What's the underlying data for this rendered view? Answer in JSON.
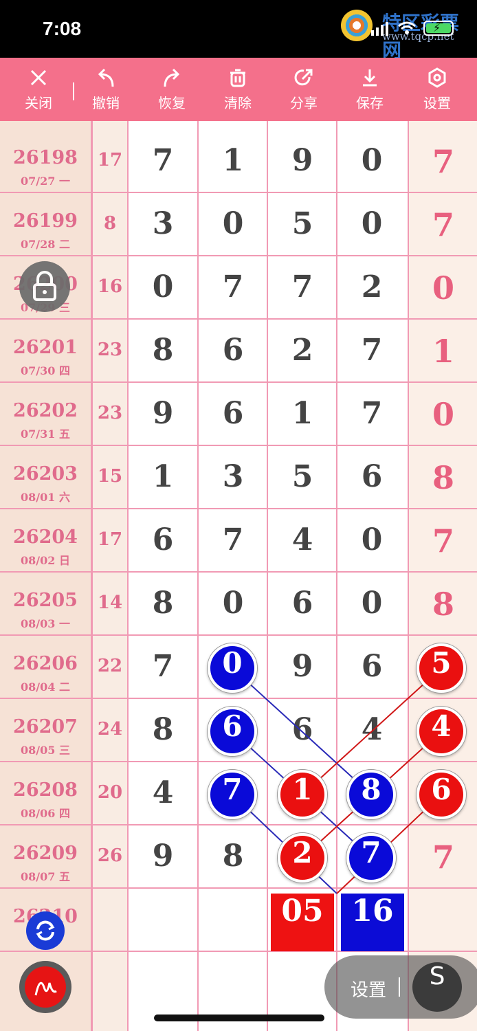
{
  "status_bar": {
    "time": "7:08"
  },
  "watermark": {
    "title": "特区彩票网",
    "url": "www.tqcp.net"
  },
  "toolbar": {
    "close": "关闭",
    "undo": "撤销",
    "redo": "恢复",
    "clear": "清除",
    "share": "分享",
    "save": "保存",
    "settings": "设置"
  },
  "rows": [
    {
      "period": "26198",
      "date": "07/27 一",
      "sum": "17",
      "digits": [
        "7",
        "1",
        "9",
        "0"
      ],
      "result": "7"
    },
    {
      "period": "26199",
      "date": "07/28 二",
      "sum": "8",
      "digits": [
        "3",
        "0",
        "5",
        "0"
      ],
      "result": "7"
    },
    {
      "period": "26200",
      "date": "07/29 三",
      "sum": "16",
      "digits": [
        "0",
        "7",
        "7",
        "2"
      ],
      "result": "0"
    },
    {
      "period": "26201",
      "date": "07/30 四",
      "sum": "23",
      "digits": [
        "8",
        "6",
        "2",
        "7"
      ],
      "result": "1"
    },
    {
      "period": "26202",
      "date": "07/31 五",
      "sum": "23",
      "digits": [
        "9",
        "6",
        "1",
        "7"
      ],
      "result": "0"
    },
    {
      "period": "26203",
      "date": "08/01 六",
      "sum": "15",
      "digits": [
        "1",
        "3",
        "5",
        "6"
      ],
      "result": "8"
    },
    {
      "period": "26204",
      "date": "08/02 日",
      "sum": "17",
      "digits": [
        "6",
        "7",
        "4",
        "0"
      ],
      "result": "7"
    },
    {
      "period": "26205",
      "date": "08/03 一",
      "sum": "14",
      "digits": [
        "8",
        "0",
        "6",
        "0"
      ],
      "result": "8"
    },
    {
      "period": "26206",
      "date": "08/04 二",
      "sum": "22",
      "digits": [
        "7",
        "0",
        "9",
        "6"
      ],
      "result": "5"
    },
    {
      "period": "26207",
      "date": "08/05 三",
      "sum": "24",
      "digits": [
        "8",
        "6",
        "6",
        "4"
      ],
      "result": "4"
    },
    {
      "period": "26208",
      "date": "08/06 四",
      "sum": "20",
      "digits": [
        "4",
        "7",
        "1",
        "8"
      ],
      "result": "6"
    },
    {
      "period": "26209",
      "date": "08/07 五",
      "sum": "26",
      "digits": [
        "9",
        "8",
        "2",
        "7"
      ],
      "result": "7"
    },
    {
      "period": "26210",
      "date": "",
      "sum": "",
      "digits": [
        "",
        "",
        "",
        ""
      ],
      "result": ""
    }
  ],
  "highlighted_row_index": [
    8,
    9,
    10,
    11
  ],
  "prediction_boxes": {
    "red": "05",
    "blue": "16"
  },
  "floating": {
    "settings_label": "设置",
    "s_button": "S"
  },
  "colors": {
    "toolbar": "#f4708b",
    "blue_ball": "#0a0ad8",
    "red_ball": "#ea1010",
    "grid_line": "#f19ab4"
  }
}
